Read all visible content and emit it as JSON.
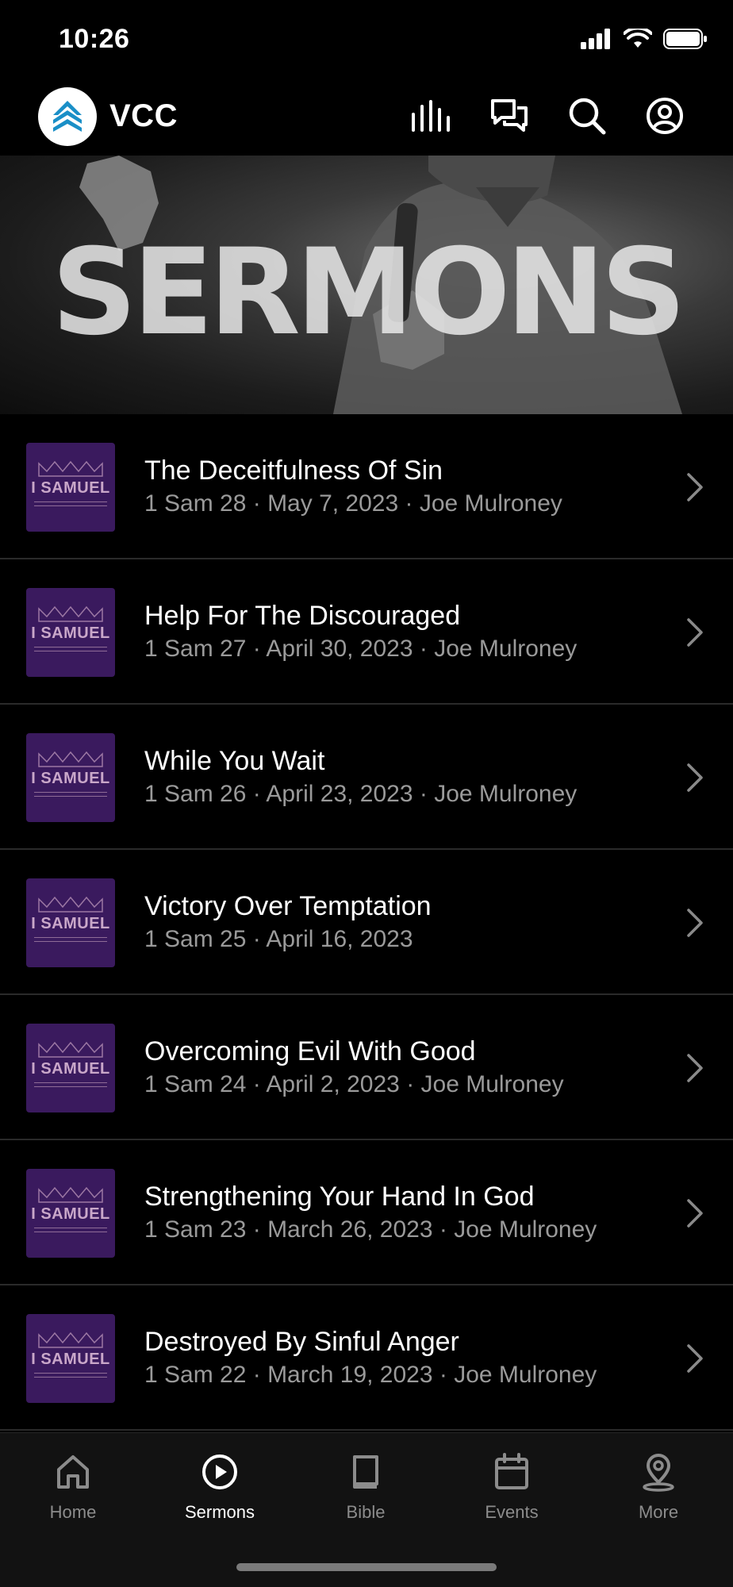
{
  "status_bar": {
    "time": "10:26"
  },
  "header": {
    "app_name": "VCC",
    "icons": [
      "audio-bars-icon",
      "chat-bubbles-icon",
      "search-icon",
      "profile-icon"
    ]
  },
  "banner": {
    "title": "SERMONS"
  },
  "sermons": [
    {
      "title": "The Deceitfulness Of Sin",
      "meta": "1 Sam 28 · May 7, 2023 · Joe Mulroney",
      "thumb_label": "I SAMUEL"
    },
    {
      "title": "Help For The Discouraged",
      "meta": "1 Sam 27 · April 30, 2023 · Joe Mulroney",
      "thumb_label": "I SAMUEL"
    },
    {
      "title": "While You Wait",
      "meta": "1 Sam 26 · April 23, 2023 · Joe Mulroney",
      "thumb_label": "I SAMUEL"
    },
    {
      "title": "Victory Over Temptation",
      "meta": "1 Sam 25 · April 16, 2023",
      "thumb_label": "I SAMUEL"
    },
    {
      "title": "Overcoming Evil With Good",
      "meta": "1 Sam 24 · April 2, 2023 · Joe Mulroney",
      "thumb_label": "I SAMUEL"
    },
    {
      "title": "Strengthening Your Hand In God",
      "meta": "1 Sam 23 · March 26, 2023 · Joe Mulroney",
      "thumb_label": "I SAMUEL"
    },
    {
      "title": "Destroyed By Sinful Anger",
      "meta": "1 Sam 22 · March 19, 2023 · Joe Mulroney",
      "thumb_label": "I SAMUEL"
    }
  ],
  "tabs": [
    {
      "label": "Home",
      "icon": "home-icon",
      "active": false
    },
    {
      "label": "Sermons",
      "icon": "play-circle-icon",
      "active": true
    },
    {
      "label": "Bible",
      "icon": "book-icon",
      "active": false
    },
    {
      "label": "Events",
      "icon": "calendar-icon",
      "active": false
    },
    {
      "label": "More",
      "icon": "location-pin-icon",
      "active": false
    }
  ],
  "colors": {
    "background": "#000000",
    "logo_accent": "#1a8fc7",
    "thumb_purple": "#3a1a5e",
    "meta_text": "#9a9a9a",
    "tab_inactive": "#8c8c8c"
  }
}
